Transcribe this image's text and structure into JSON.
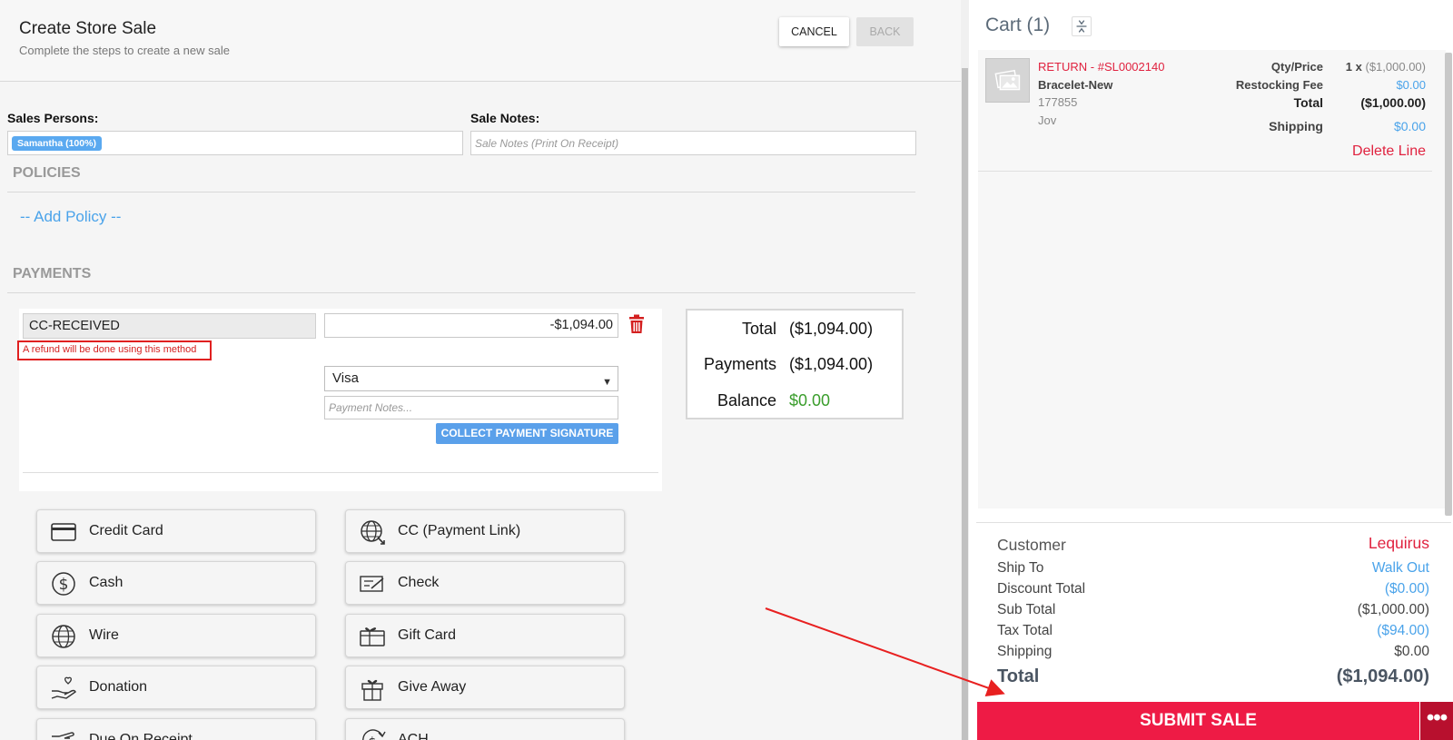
{
  "header": {
    "title": "Create Store Sale",
    "subtitle": "Complete the steps to create a new sale",
    "cancel_label": "CANCEL",
    "back_label": "BACK"
  },
  "sales_persons": {
    "label": "Sales Persons:",
    "chip": "Samantha (100%)"
  },
  "sale_notes": {
    "label": "Sale Notes:",
    "placeholder": "Sale Notes (Print On Receipt)"
  },
  "policies": {
    "title": "POLICIES",
    "add_label": "-- Add Policy --"
  },
  "payments": {
    "title": "PAYMENTS",
    "method": "CC-RECEIVED",
    "refund_note": "A refund will be done using this method",
    "amount": "-$1,094.00",
    "card_type": "Visa",
    "notes_placeholder": "Payment Notes...",
    "collect_signature_label": "COLLECT PAYMENT SIGNATURE"
  },
  "totals": {
    "total_label": "Total",
    "total_value": "($1,094.00)",
    "payments_label": "Payments",
    "payments_value": "($1,094.00)",
    "balance_label": "Balance",
    "balance_value": "$0.00"
  },
  "payment_methods": [
    {
      "label": "Credit Card",
      "icon": "credit-card-icon"
    },
    {
      "label": "CC (Payment Link)",
      "icon": "globe-link-icon"
    },
    {
      "label": "Cash",
      "icon": "dollar-circle-icon"
    },
    {
      "label": "Check",
      "icon": "check-icon"
    },
    {
      "label": "Wire",
      "icon": "globe-icon"
    },
    {
      "label": "Gift Card",
      "icon": "gift-card-icon"
    },
    {
      "label": "Donation",
      "icon": "donation-hand-icon"
    },
    {
      "label": "Give Away",
      "icon": "gift-icon"
    },
    {
      "label": "Due On Receipt",
      "icon": "hand-icon"
    },
    {
      "label": "ACH",
      "icon": "ach-icon"
    }
  ],
  "cart": {
    "title": "Cart (1)",
    "item": {
      "title": "RETURN - #SL0002140",
      "name": "Bracelet-New",
      "sku": "177855",
      "owner": "Jov",
      "qty_price_label": "Qty/Price",
      "qty_price_qty": "1 x",
      "qty_price_value": "($1,000.00)",
      "restocking_label": "Restocking Fee",
      "restocking_value": "$0.00",
      "total_label": "Total",
      "total_value": "($1,000.00)",
      "shipping_label": "Shipping",
      "shipping_value": "$0.00",
      "delete_label": "Delete Line"
    },
    "summary": {
      "customer_label": "Customer",
      "customer_value": "Lequirus",
      "ship_to_label": "Ship To",
      "ship_to_value": "Walk Out",
      "discount_label": "Discount Total",
      "discount_value": "($0.00)",
      "subtotal_label": "Sub Total",
      "subtotal_value": "($1,000.00)",
      "tax_label": "Tax Total",
      "tax_value": "($94.00)",
      "shipping_label": "Shipping",
      "shipping_value": "$0.00",
      "total_label": "Total",
      "total_value": "($1,094.00)"
    },
    "submit_label": "SUBMIT SALE",
    "more_label": "•••"
  },
  "colors": {
    "accent_blue": "#4aa3ea",
    "danger_red": "#e0223f",
    "submit_red": "#ee1b45",
    "balance_green": "#3a9d2c"
  }
}
